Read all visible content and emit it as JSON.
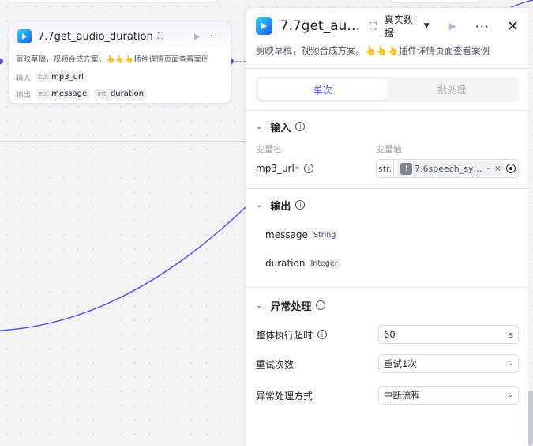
{
  "node": {
    "title": "7.7get_audio_duration",
    "description": "剪映草稿，视频合成方案。👆👆👆插件详情页面查看案例",
    "input_label": "输入",
    "output_label": "输出",
    "inputs": [
      {
        "type": "str.",
        "name": "mp3_url"
      }
    ],
    "outputs": [
      {
        "type": "str.",
        "name": "message"
      },
      {
        "type": "int.",
        "name": "duration"
      }
    ]
  },
  "panel": {
    "title": "7.7get_au…",
    "mode": "真实数据",
    "description": "剪映草稿，视频合成方案。👆👆👆插件详情页面查看案例",
    "tabs": {
      "single": "单次",
      "batch": "批处理"
    },
    "input_section": {
      "title": "输入",
      "col_name": "变量名",
      "col_value": "变量值",
      "var_name": "mp3_url",
      "var_type": "str.",
      "ref_text": "7.6speech_sy…",
      "ref_sep": "-"
    },
    "output_section": {
      "title": "输出",
      "items": [
        {
          "name": "message",
          "type": "String"
        },
        {
          "name": "duration",
          "type": "Integer"
        }
      ]
    },
    "exception_section": {
      "title": "异常处理",
      "timeout_label": "整体执行超时",
      "timeout_value": "60",
      "timeout_unit": "s",
      "retry_label": "重试次数",
      "retry_value": "重试1次",
      "handling_label": "异常处理方式",
      "handling_value": "中断流程"
    }
  },
  "colors": {
    "accent": "#4d53e8",
    "wire": "#4d53e8"
  },
  "icons": [
    "app-logo-icon",
    "tag-icon",
    "run-icon",
    "more-icon",
    "close-icon",
    "chevron-down-icon",
    "info-icon",
    "warning-icon",
    "target-icon"
  ]
}
